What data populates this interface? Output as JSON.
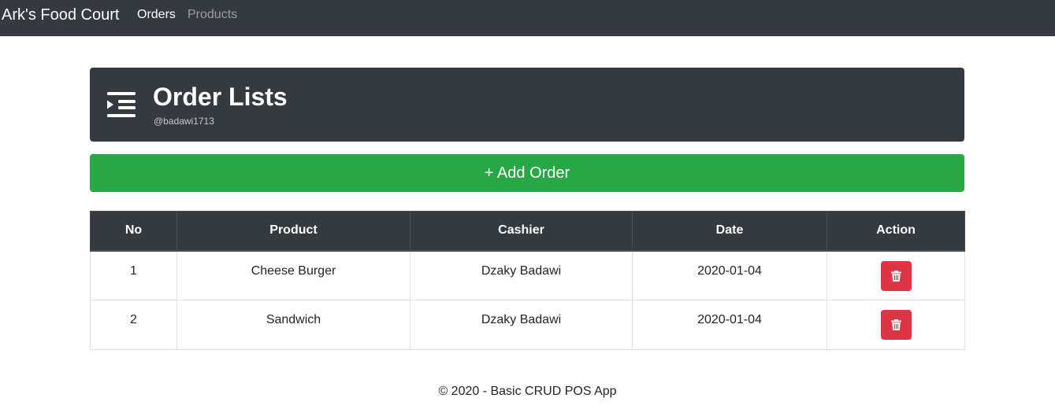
{
  "navbar": {
    "brand": "Ark's Food Court",
    "links": [
      {
        "label": "Orders",
        "active": true
      },
      {
        "label": "Products",
        "active": false
      }
    ]
  },
  "header": {
    "icon": "list-indent-icon",
    "title": "Order Lists",
    "subtitle": "@badawi1713"
  },
  "add_button": {
    "label": "+ Add Order"
  },
  "table": {
    "columns": [
      "No",
      "Product",
      "Cashier",
      "Date",
      "Action"
    ],
    "rows": [
      {
        "no": "1",
        "product": "Cheese Burger",
        "cashier": "Dzaky Badawi",
        "date": "2020-01-04",
        "action_icon": "trash-icon"
      },
      {
        "no": "2",
        "product": "Sandwich",
        "cashier": "Dzaky Badawi",
        "date": "2020-01-04",
        "action_icon": "trash-icon"
      }
    ]
  },
  "footer": {
    "text": "© 2020 - Basic CRUD POS App"
  },
  "colors": {
    "navbar_bg": "#343a40",
    "success": "#28a745",
    "danger": "#dc3545",
    "table_header_bg": "#343a40"
  }
}
